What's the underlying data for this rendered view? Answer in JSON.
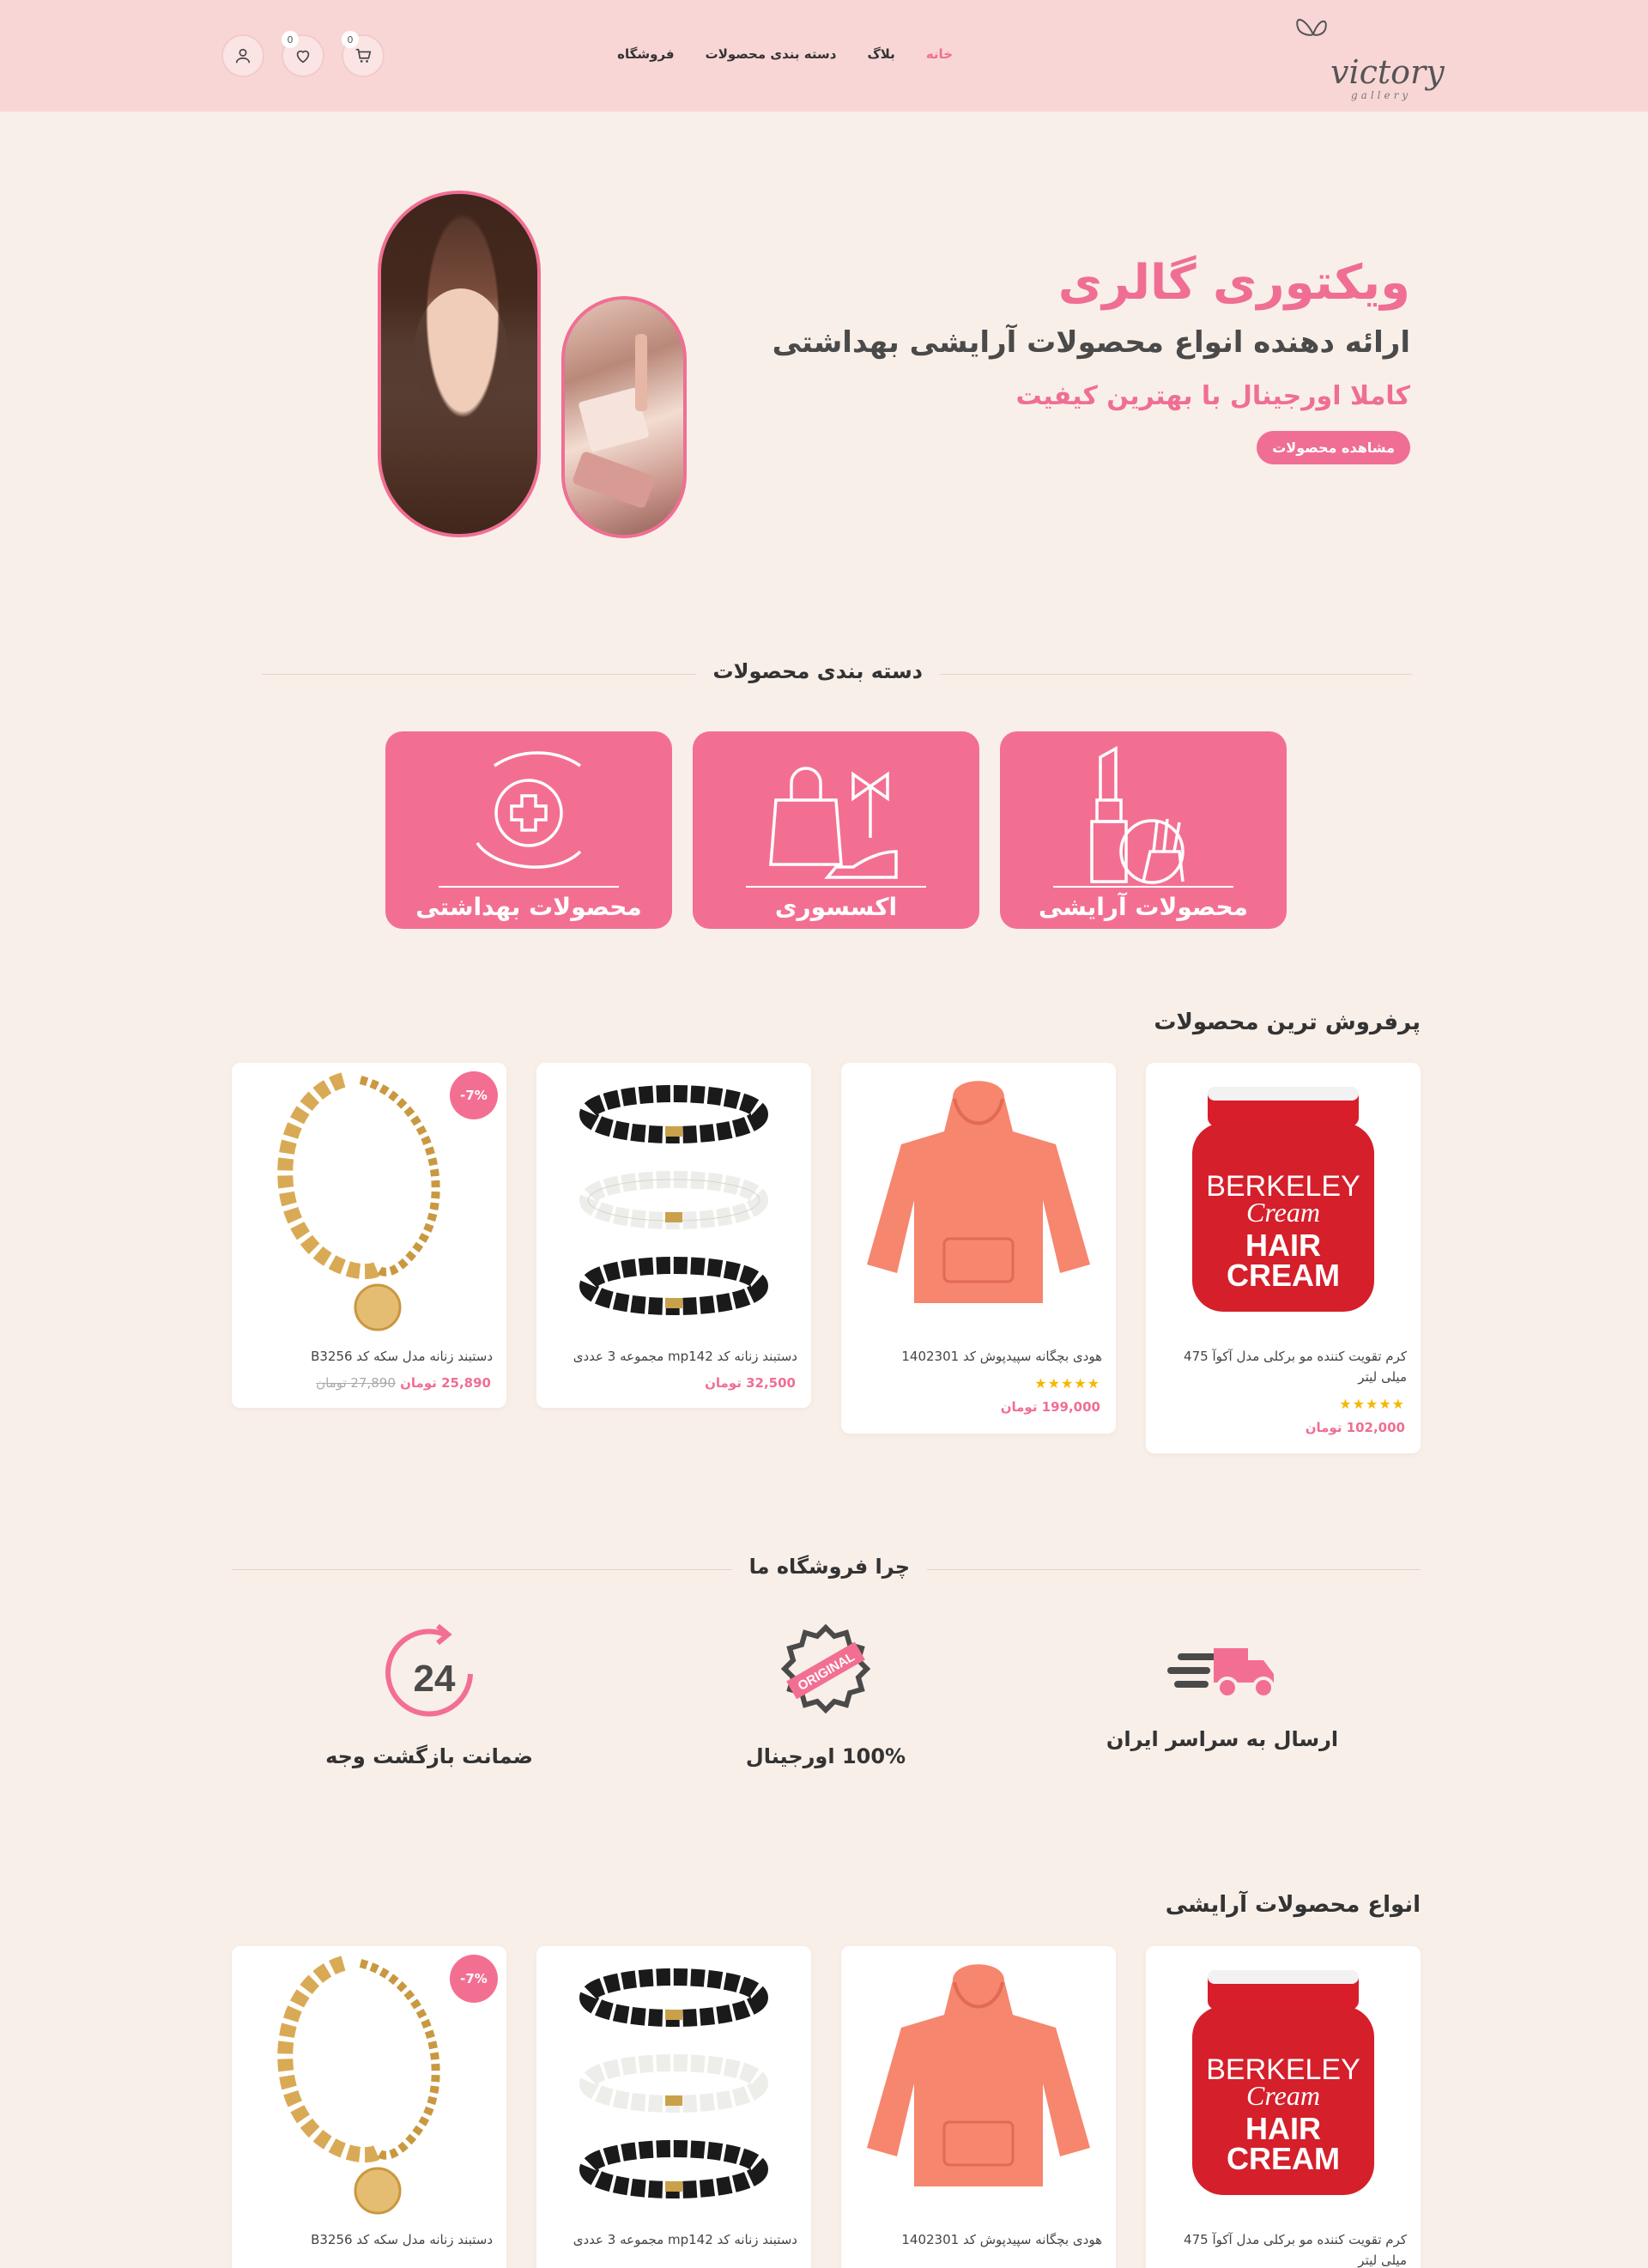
{
  "header": {
    "logo": {
      "word": "victory",
      "sub": "gallery"
    },
    "nav": [
      {
        "label": "خانه",
        "active": true
      },
      {
        "label": "بلاگ",
        "active": false
      },
      {
        "label": "دسته بندی محصولات",
        "active": false
      },
      {
        "label": "فروشگاه",
        "active": false
      }
    ],
    "cart_count": "0",
    "wishlist_count": "0",
    "icons": [
      "cart-icon",
      "heart-icon",
      "user-icon"
    ]
  },
  "hero": {
    "title": "ویکتوری گالری",
    "subtitle": "ارائه دهنده انواع محصولات آرایشی بهداشتی",
    "tagline": "کاملا اورجینال با بهترین کیفیت",
    "button": "مشاهده محصولات"
  },
  "categories": {
    "title": "دسته بندی محصولات",
    "items": [
      {
        "label": "محصولات آرایشی",
        "icon": "lipstick-icon"
      },
      {
        "label": "اکسسوری",
        "icon": "bag-shoe-icon"
      },
      {
        "label": "محصولات بهداشتی",
        "icon": "health-hand-icon"
      }
    ]
  },
  "bestsellers": {
    "title": "پرفروش ترین محصولات",
    "products": [
      {
        "name": "کرم تقویت کننده مو برکلی مدل آکوآ 475 میلی لیتر",
        "stars": "★★★★★",
        "price": "102,000 تومان",
        "old_price": "",
        "sale": ""
      },
      {
        "name": "هودی بچگانه سپیدپوش کد 1402301",
        "stars": "★★★★★",
        "price": "199,000 تومان",
        "old_price": "",
        "sale": ""
      },
      {
        "name": "دستبند زنانه کد mp142 مجموعه 3 عددی",
        "stars": "",
        "price": "32,500 تومان",
        "old_price": "",
        "sale": ""
      },
      {
        "name": "دستبند زنانه مدل سکه کد B3256",
        "stars": "",
        "price": "25,890 تومان",
        "old_price": "27,890 تومان",
        "sale": "-7%"
      }
    ]
  },
  "why": {
    "title": "چرا فروشگاه ما",
    "items": [
      {
        "label": "ارسال به سراسر ایران",
        "icon": "delivery-truck-icon"
      },
      {
        "label": "100% اورجینال",
        "icon": "original-stamp-icon"
      },
      {
        "label": "ضمانت بازگشت وجه",
        "icon": "24-hours-icon"
      }
    ],
    "icon_text_24": "24",
    "icon_text_original": "ORIGINAL"
  },
  "cosmetics": {
    "title": "انواع محصولات آرایشی",
    "products": [
      {
        "name": "کرم تقویت کننده مو برکلی مدل آکوآ 475 میلی لیتر"
      },
      {
        "name": "هودی بچگانه سپیدپوش کد 1402301"
      },
      {
        "name": "دستبند زنانه کد mp142 مجموعه 3 عددی"
      },
      {
        "name": "دستبند زنانه مدل سکه کد B3256",
        "sale": "-7%"
      }
    ]
  },
  "product_art": {
    "cream_brand": "BERKELEY",
    "cream_line": "Cream",
    "cream_hair": "HAIR",
    "cream_word": "CREAM"
  },
  "colors": {
    "accent": "#f06e93",
    "header_bg": "#f9d6d6",
    "page_bg": "#f9efe9",
    "category_bg": "#f36f92",
    "star": "#f5b700"
  }
}
